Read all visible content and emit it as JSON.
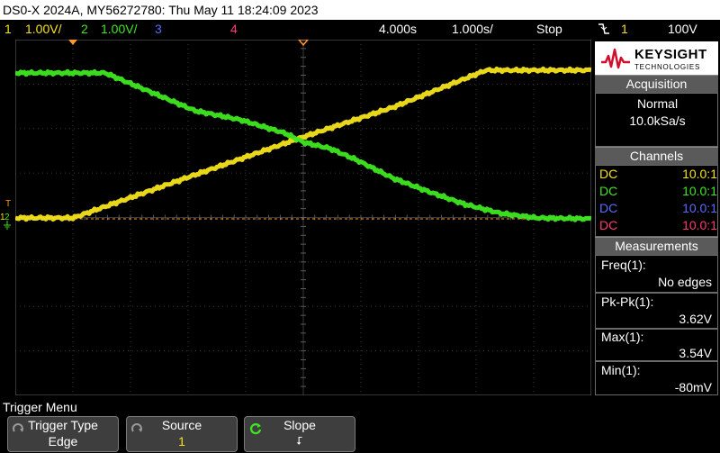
{
  "title": "DS0-X 2024A, MY56272780: Thu May 11 18:24:09 2023",
  "status": {
    "ch1_num": "1",
    "ch1_scale": "1.00V/",
    "ch2_num": "2",
    "ch2_scale": "1.00V/",
    "ch3_num": "3",
    "ch4_num": "4",
    "time_delay": "4.000s",
    "time_base": "1.000s/",
    "run_state": "Stop",
    "trigger_slope_icon": "falling-edge-icon",
    "trigger_source": "1",
    "trigger_level": "100V"
  },
  "colors": {
    "ch1": "#f5e31a",
    "ch2": "#3ee820",
    "ch3": "#5a6cff",
    "ch4": "#ff3a72",
    "trigger": "#ff9a2a"
  },
  "logo": {
    "brand": "KEYSIGHT",
    "sub": "TECHNOLOGIES"
  },
  "acquisition": {
    "header": "Acquisition",
    "mode": "Normal",
    "rate": "10.0kSa/s"
  },
  "channels": {
    "header": "Channels",
    "rows": [
      {
        "coupling": "DC",
        "probe": "10.0:1"
      },
      {
        "coupling": "DC",
        "probe": "10.0:1"
      },
      {
        "coupling": "DC",
        "probe": "10.0:1"
      },
      {
        "coupling": "DC",
        "probe": "10.0:1"
      }
    ]
  },
  "measurements": {
    "header": "Measurements",
    "items": [
      {
        "label": "Freq(1):",
        "value": "No edges"
      },
      {
        "label": "Pk-Pk(1):",
        "value": "3.62V"
      },
      {
        "label": "Max(1):",
        "value": "3.54V"
      },
      {
        "label": "Min(1):",
        "value": "-80mV"
      }
    ]
  },
  "menu": {
    "title": "Trigger Menu",
    "softkeys": [
      {
        "title": "Trigger Type",
        "value": "Edge"
      },
      {
        "title": "Source",
        "value": "1"
      },
      {
        "title": "Slope",
        "value": "⮦"
      }
    ]
  },
  "markers": {
    "ch_marker_1": "1",
    "ch_marker_2": "2",
    "trig_marker": "T"
  }
}
